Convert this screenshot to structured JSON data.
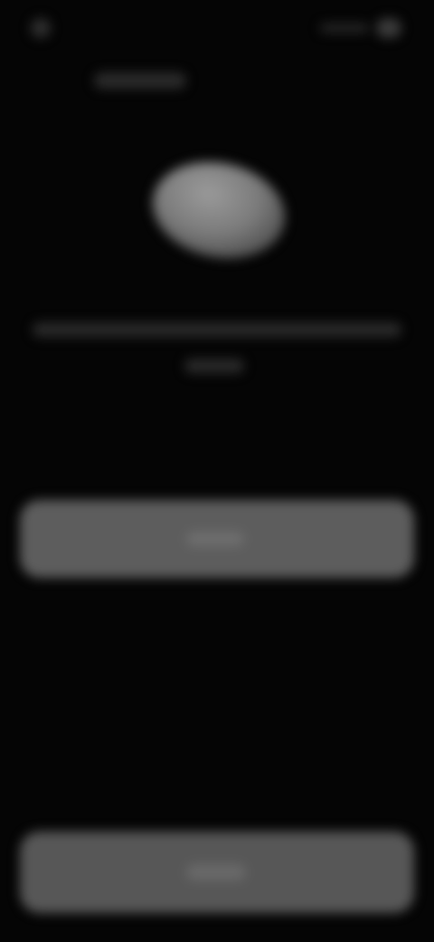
{
  "colors": {
    "background": "#050505",
    "primary_button": "#5d5d5d",
    "secondary_button": "#575757"
  },
  "icons": {
    "device": "device-image"
  }
}
